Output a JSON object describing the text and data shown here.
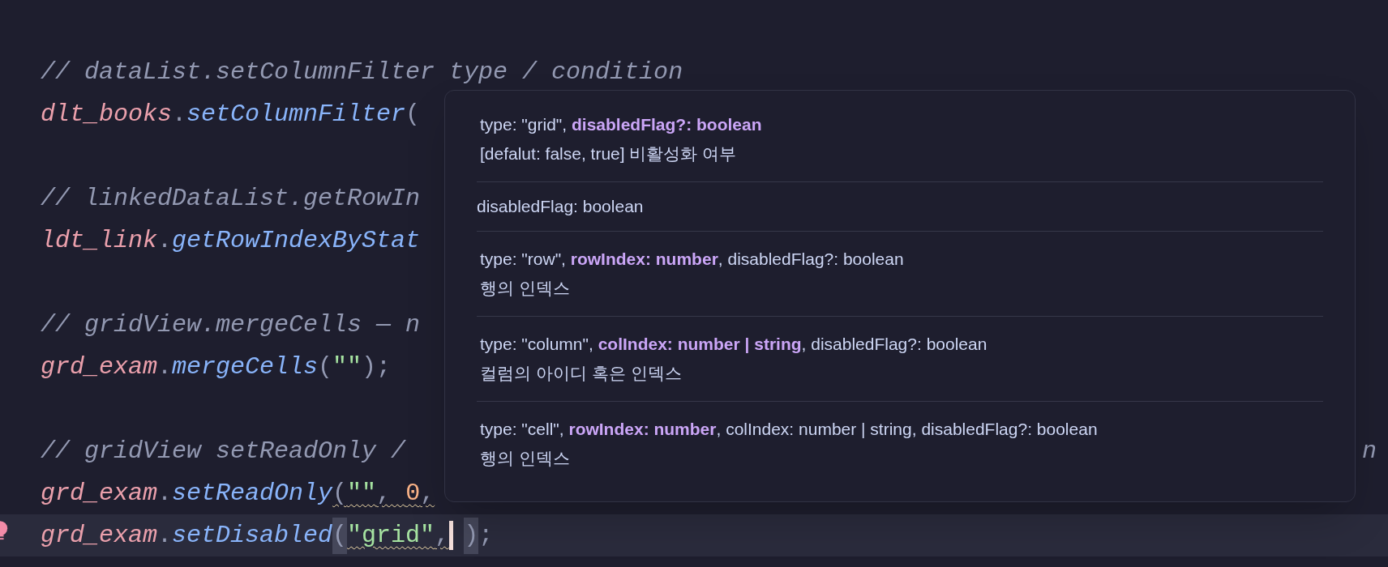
{
  "editor": {
    "lines": [
      {
        "kind": "code",
        "current": false,
        "tokens": [
          {
            "kind": "comment",
            "text": "// dataList.setColumnFilter type / condition"
          }
        ]
      },
      {
        "kind": "code",
        "current": false,
        "tokens": [
          {
            "kind": "variable",
            "text": "dlt_books"
          },
          {
            "kind": "punct",
            "text": "."
          },
          {
            "kind": "method",
            "text": "setColumnFilter"
          },
          {
            "kind": "punct",
            "text": "("
          }
        ]
      },
      {
        "kind": "blank"
      },
      {
        "kind": "code",
        "current": false,
        "tokens": [
          {
            "kind": "comment",
            "text": "// linkedDataList.getRowIn"
          }
        ]
      },
      {
        "kind": "code",
        "current": false,
        "tokens": [
          {
            "kind": "variable",
            "text": "ldt_link"
          },
          {
            "kind": "punct",
            "text": "."
          },
          {
            "kind": "method",
            "text": "getRowIndexByStat"
          }
        ]
      },
      {
        "kind": "blank"
      },
      {
        "kind": "code",
        "current": false,
        "tokens": [
          {
            "kind": "comment",
            "text": "// gridView.mergeCells — n"
          }
        ]
      },
      {
        "kind": "code",
        "current": false,
        "tokens": [
          {
            "kind": "variable",
            "text": "grd_exam"
          },
          {
            "kind": "punct",
            "text": "."
          },
          {
            "kind": "method",
            "text": "mergeCells"
          },
          {
            "kind": "punct",
            "text": "("
          },
          {
            "kind": "string",
            "text": "\"\""
          },
          {
            "kind": "punct",
            "text": ");"
          }
        ]
      },
      {
        "kind": "blank"
      },
      {
        "kind": "code",
        "current": false,
        "tokens": [
          {
            "kind": "comment",
            "text": "// gridView setReadOnly /"
          },
          {
            "kind": "tail",
            "text": "n"
          }
        ]
      },
      {
        "kind": "code",
        "current": false,
        "tokens": [
          {
            "kind": "variable",
            "text": "grd_exam"
          },
          {
            "kind": "punct",
            "text": "."
          },
          {
            "kind": "method",
            "text": "setReadOnly"
          },
          {
            "kind": "punct",
            "text": "(",
            "warning": true
          },
          {
            "kind": "string",
            "text": "\"\"",
            "warning": true
          },
          {
            "kind": "punct",
            "text": ", ",
            "warning": true
          },
          {
            "kind": "number",
            "text": "0",
            "warning": true
          },
          {
            "kind": "punct",
            "text": ",",
            "warning": true
          }
        ]
      },
      {
        "kind": "code",
        "current": true,
        "tokens": [
          {
            "kind": "variable",
            "text": "grd_exam"
          },
          {
            "kind": "punct",
            "text": "."
          },
          {
            "kind": "method",
            "text": "setDisabled"
          },
          {
            "kind": "bracket_match",
            "text": "("
          },
          {
            "kind": "string",
            "text": "\"grid\"",
            "warning": true
          },
          {
            "kind": "punct",
            "text": ",",
            "warning": true
          },
          {
            "kind": "cursor"
          },
          {
            "kind": "bracket_match",
            "text": ")"
          },
          {
            "kind": "punct",
            "text": ";"
          }
        ]
      }
    ]
  },
  "signature_popup": {
    "items": [
      {
        "kind": "overload",
        "signature": "type: \"grid\", **disabledFlag?: boolean**",
        "description": "[defalut: false, true] 비활성화 여부"
      },
      {
        "kind": "parameter",
        "signature": "disabledFlag: boolean"
      },
      {
        "kind": "overload",
        "signature": "type: \"row\", **rowIndex: number**, disabledFlag?: boolean",
        "description": "행의 인덱스"
      },
      {
        "kind": "overload",
        "signature": "type: \"column\", **colIndex: number | string**, disabledFlag?: boolean",
        "description": "컬럼의 아이디 혹은 인덱스"
      },
      {
        "kind": "overload",
        "signature": "type: \"cell\", **rowIndex: number**, colIndex: number | string, disabledFlag?: boolean",
        "description": "행의 인덱스"
      }
    ]
  }
}
